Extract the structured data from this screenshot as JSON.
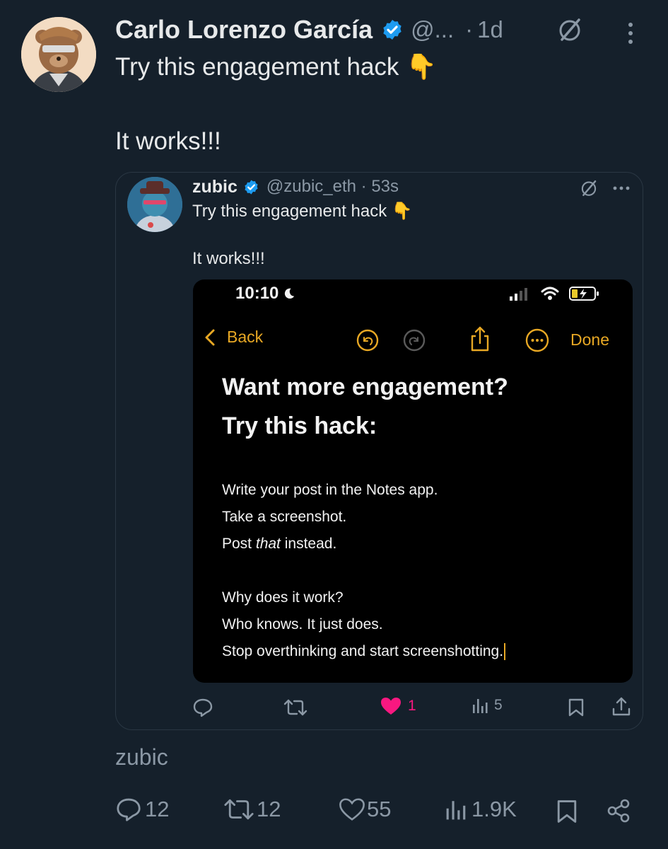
{
  "post": {
    "author_name": "Carlo Lorenzo García",
    "handle": "@...",
    "separator": "·",
    "time": "1d",
    "text_line1": "Try this engagement hack 👇",
    "text_line2": "It works!!!"
  },
  "quoted": {
    "author_name": "zubic",
    "handle_time": "@zubic_eth · 53s",
    "text_line1": "Try this engagement hack 👇",
    "text_line2": "It works!!!",
    "phone": {
      "clock": "10:10",
      "back_label": "Back",
      "done_label": "Done",
      "heading_line1": "Want more engagement?",
      "heading_line2": "Try this hack:",
      "body_line1": "Write your post in the Notes app.",
      "body_line2": "Take a screenshot.",
      "body_line3_pre": "Post ",
      "body_line3_em": "that",
      "body_line3_post": " instead.",
      "body_line4": "Why does it work?",
      "body_line5": "Who knows. It just does.",
      "body_line6": "Stop overthinking and start screenshotting."
    },
    "actions": {
      "likes": "1",
      "views": "5"
    }
  },
  "reply_label": "zubic",
  "actions": {
    "replies": "12",
    "reposts": "12",
    "likes": "55",
    "views": "1.9K"
  },
  "colors": {
    "background": "#15202b",
    "verified": "#1d9bf0",
    "like_pink": "#f91880",
    "notes_accent": "#e8a824",
    "secondary_text": "#8b98a5"
  },
  "icons": [
    "verified-badge-icon",
    "grok-icon",
    "more-vertical-icon",
    "more-horizontal-icon",
    "reply-icon",
    "repost-icon",
    "like-icon",
    "views-icon",
    "bookmark-icon",
    "share-icon",
    "chevron-left-icon",
    "undo-icon",
    "redo-icon",
    "share-up-icon",
    "ellipsis-circle-icon",
    "moon-icon",
    "signal-icon",
    "wifi-icon",
    "battery-icon"
  ]
}
